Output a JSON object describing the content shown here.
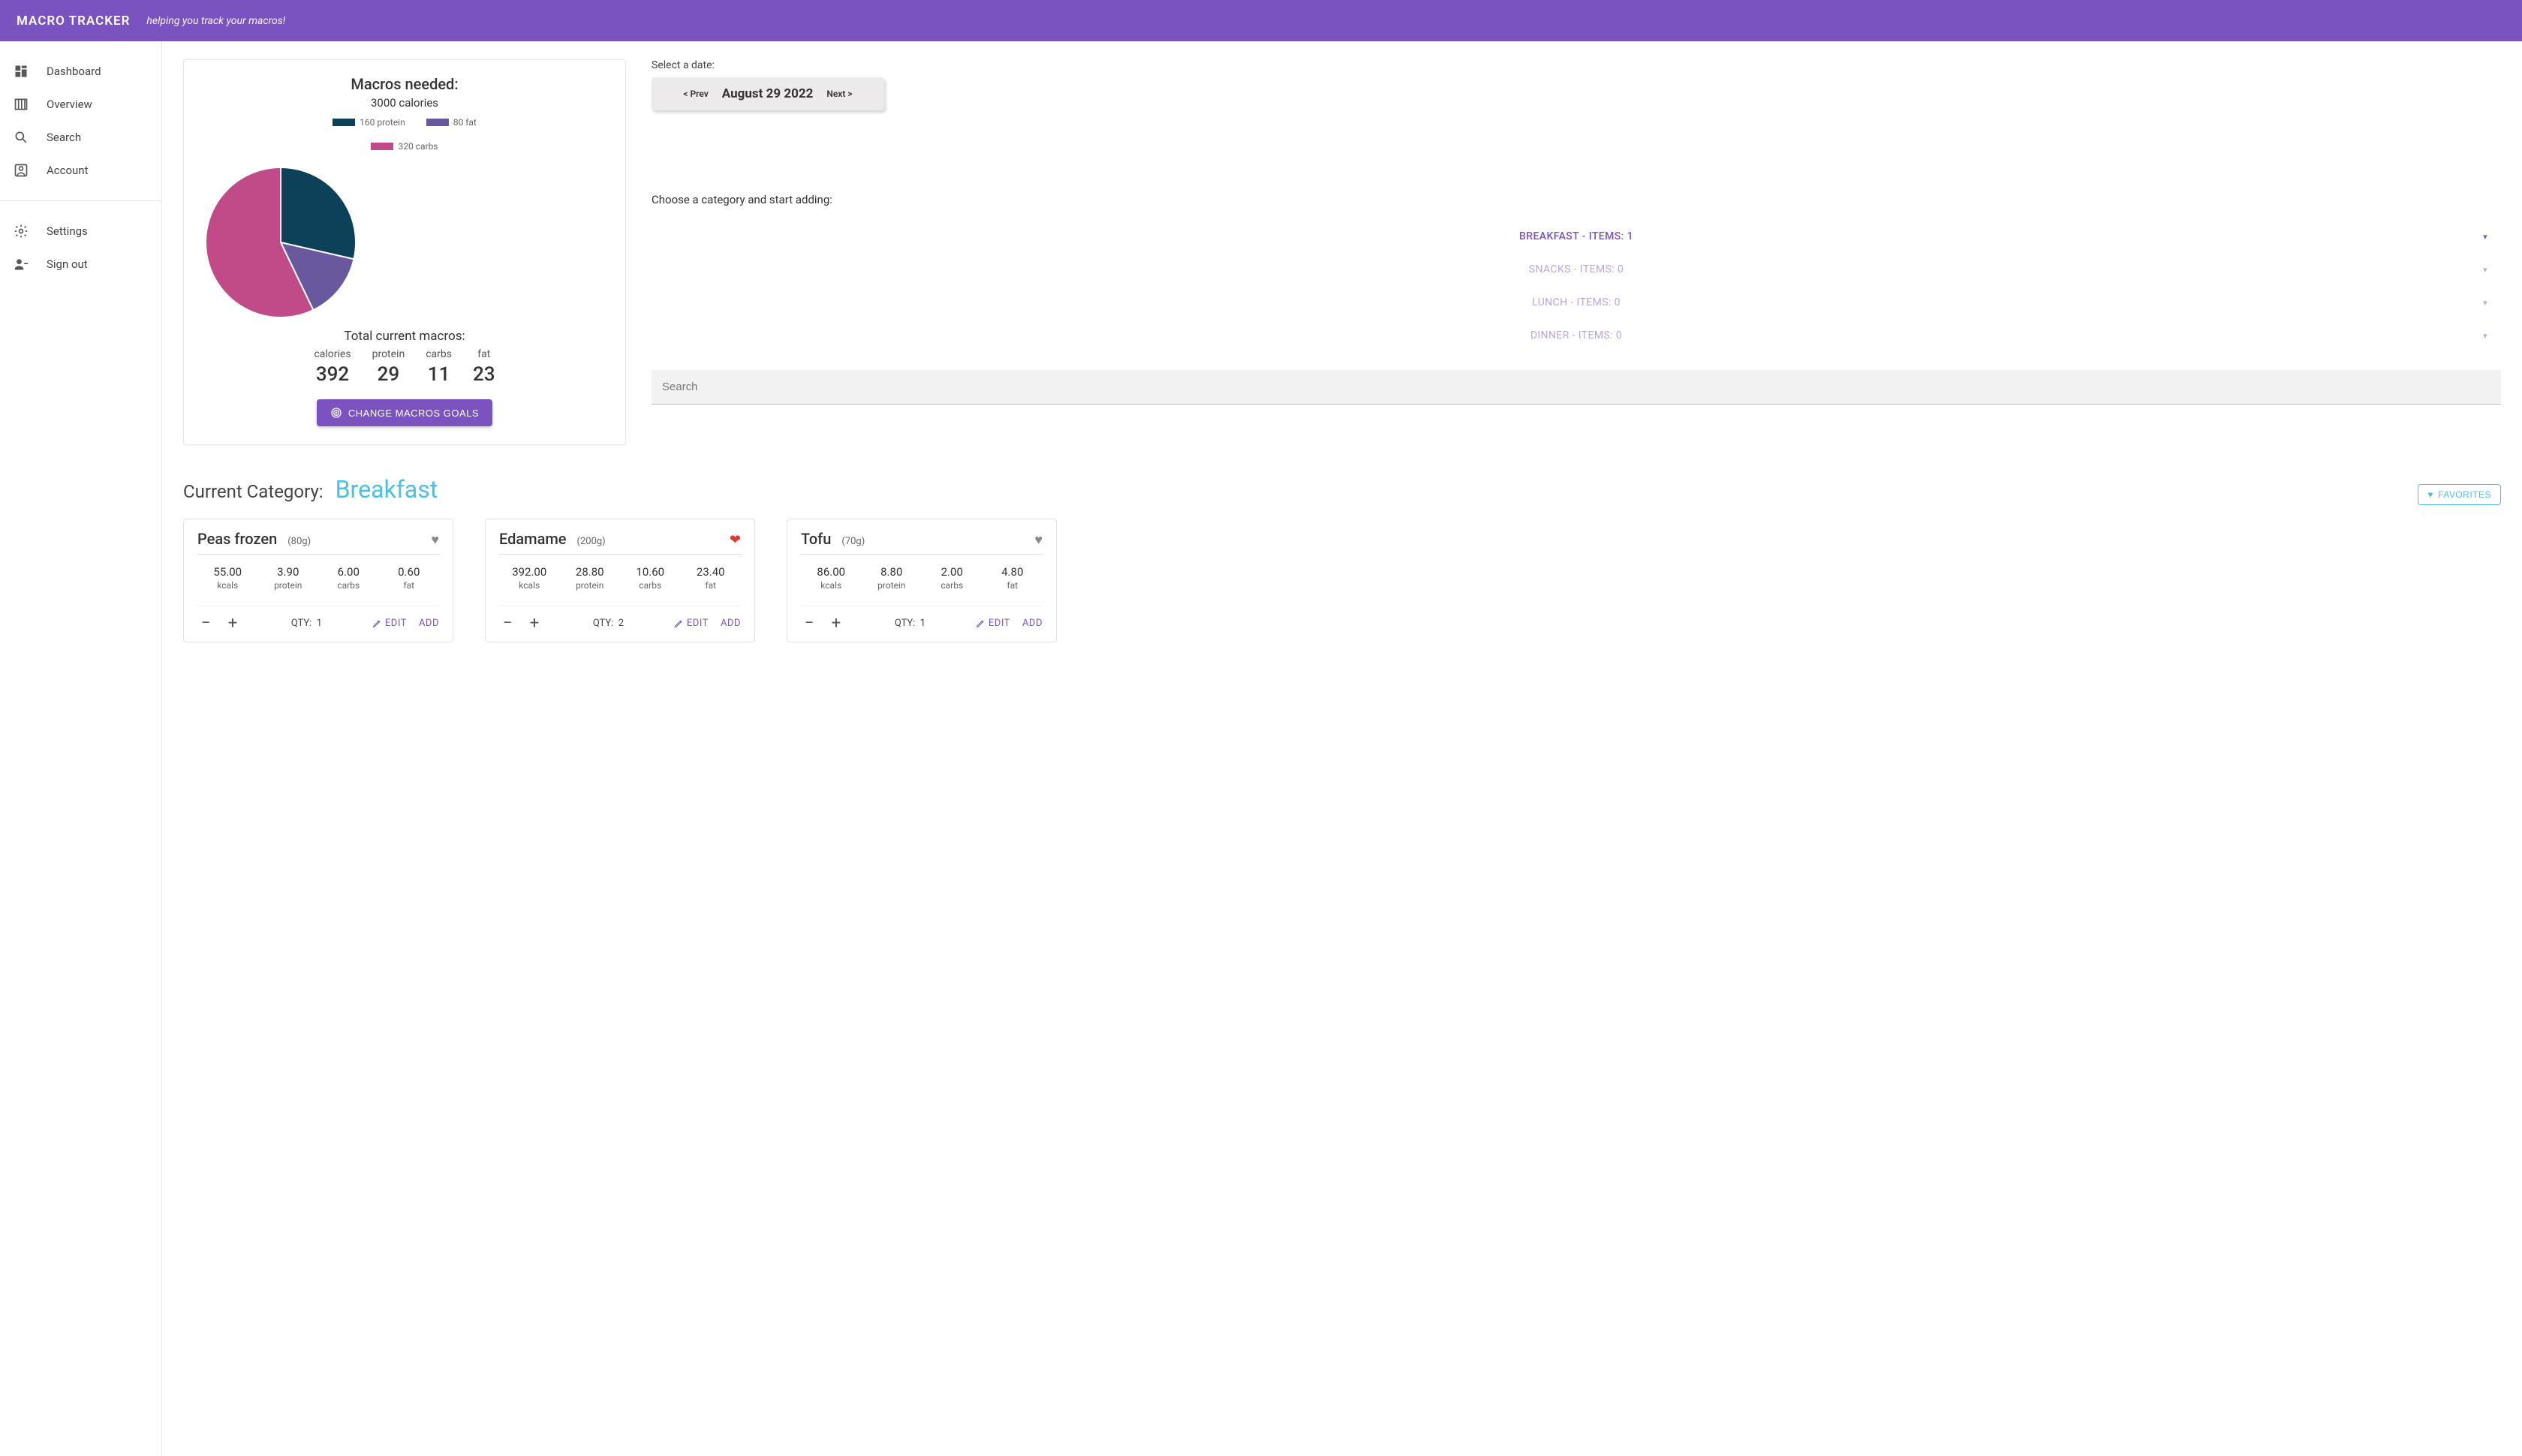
{
  "header": {
    "brand": "MACRO TRACKER",
    "tagline": "helping you track your macros!"
  },
  "sidebar": {
    "primary": [
      {
        "label": "Dashboard",
        "icon": "dashboard-icon"
      },
      {
        "label": "Overview",
        "icon": "columns-icon"
      },
      {
        "label": "Search",
        "icon": "search-icon"
      },
      {
        "label": "Account",
        "icon": "account-icon"
      }
    ],
    "secondary": [
      {
        "label": "Settings",
        "icon": "gear-icon"
      },
      {
        "label": "Sign out",
        "icon": "signout-icon"
      }
    ]
  },
  "macros": {
    "title": "Macros needed:",
    "calories_line": "3000 calories",
    "legend": {
      "protein": "160 protein",
      "fat": "80 fat",
      "carbs": "320 carbs"
    },
    "totals_title": "Total current macros:",
    "totals": {
      "calories": {
        "label": "calories",
        "value": "392"
      },
      "protein": {
        "label": "protein",
        "value": "29"
      },
      "carbs": {
        "label": "carbs",
        "value": "11"
      },
      "fat": {
        "label": "fat",
        "value": "23"
      }
    },
    "change_btn": "CHANGE MACROS GOALS"
  },
  "colors": {
    "protein": "#0d4159",
    "fat": "#6a589f",
    "carbs": "#c14b88",
    "accent": "#7b53c1",
    "cyan": "#4cc0e0"
  },
  "chart_data": {
    "type": "pie",
    "title": "Macros needed:",
    "series": [
      {
        "name": "160 protein",
        "value": 160,
        "color": "#0d4159"
      },
      {
        "name": "80 fat",
        "value": 80,
        "color": "#6a589f"
      },
      {
        "name": "320 carbs",
        "value": 320,
        "color": "#c14b88"
      }
    ]
  },
  "date": {
    "label": "Select a date:",
    "prev": "< Prev",
    "current": "August 29 2022",
    "next": "Next >"
  },
  "categories": {
    "label": "Choose a category and start adding:",
    "items": [
      {
        "label": "BREAKFAST - ITEMS: 1",
        "active": true
      },
      {
        "label": "SNACKS - ITEMS: 0",
        "active": false
      },
      {
        "label": "LUNCH - ITEMS: 0",
        "active": false
      },
      {
        "label": "DINNER - ITEMS: 0",
        "active": false
      }
    ]
  },
  "search": {
    "placeholder": "Search"
  },
  "current_category": {
    "pre": "Current Category:",
    "name": "Breakfast"
  },
  "favorites_btn": "FAVORITES",
  "foods": [
    {
      "name": "Peas frozen",
      "amount": "(80g)",
      "favorite": false,
      "kcals": "55.00",
      "protein": "3.90",
      "carbs": "6.00",
      "fat": "0.60",
      "qty": "1"
    },
    {
      "name": "Edamame",
      "amount": "(200g)",
      "favorite": true,
      "kcals": "392.00",
      "protein": "28.80",
      "carbs": "10.60",
      "fat": "23.40",
      "qty": "2"
    },
    {
      "name": "Tofu",
      "amount": "(70g)",
      "favorite": false,
      "kcals": "86.00",
      "protein": "8.80",
      "carbs": "2.00",
      "fat": "4.80",
      "qty": "1"
    }
  ],
  "labels": {
    "kcals": "kcals",
    "protein": "protein",
    "carbs": "carbs",
    "fat": "fat",
    "qty": "QTY:",
    "edit": "EDIT",
    "add": "ADD"
  }
}
